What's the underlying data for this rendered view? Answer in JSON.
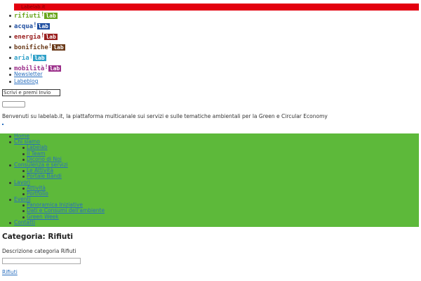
{
  "topbar": {
    "label": "Labelab.it",
    "color": "#e3000f"
  },
  "labs": [
    {
      "name": "rifiuti",
      "color": "#6aa51d",
      "lab": "lab"
    },
    {
      "name": "acqua",
      "color": "#1f4ea0",
      "lab": "lab"
    },
    {
      "name": "energia",
      "color": "#9a1f1f",
      "lab": "lab"
    },
    {
      "name": "bonifiche",
      "color": "#6b3b1a",
      "lab": "lab"
    },
    {
      "name": "aria",
      "color": "#2fa0c8",
      "lab": "lab"
    },
    {
      "name": "mobilità",
      "color": "#9b2f8a",
      "lab": "lab"
    }
  ],
  "links": {
    "newsletter": "Newsletter",
    "labeblog": "Labeblog"
  },
  "search": {
    "placeholder": "Scrivi e premi Invio"
  },
  "welcome": "Benvenuti su labelab.it, la piattaforma multicanale sui servizi e sulle tematiche ambientali per la Green e Circular Economy",
  "menu": [
    {
      "level": 1,
      "label": "Home"
    },
    {
      "level": 1,
      "label": "Chi siamo"
    },
    {
      "level": 2,
      "label": "Labelab"
    },
    {
      "level": 2,
      "label": "Il Team"
    },
    {
      "level": 2,
      "label": "Dicono di Noi"
    },
    {
      "level": 1,
      "label": "Consulenza e servizi"
    },
    {
      "level": 2,
      "label": "Le Attività"
    },
    {
      "level": 2,
      "label": "Portale Bandi"
    },
    {
      "level": 1,
      "label": "Lavori"
    },
    {
      "level": 2,
      "label": "Attività"
    },
    {
      "level": 2,
      "label": "Portfolio"
    },
    {
      "level": 1,
      "label": "Eventi"
    },
    {
      "level": 2,
      "label": "Panoramica Iniziative"
    },
    {
      "level": 2,
      "label": "Dati e Consumi dell'ambiente"
    },
    {
      "level": 2,
      "label": "Green Week"
    },
    {
      "level": 1,
      "label": "Contatti"
    }
  ],
  "category": {
    "title": "Categoria: Rifiuti",
    "description": "Descrizione categoria Rifiuti"
  },
  "bottom_link": "Rifiuti",
  "colors": {
    "menu_band": "#5db93a",
    "link": "#2a6fbf"
  }
}
